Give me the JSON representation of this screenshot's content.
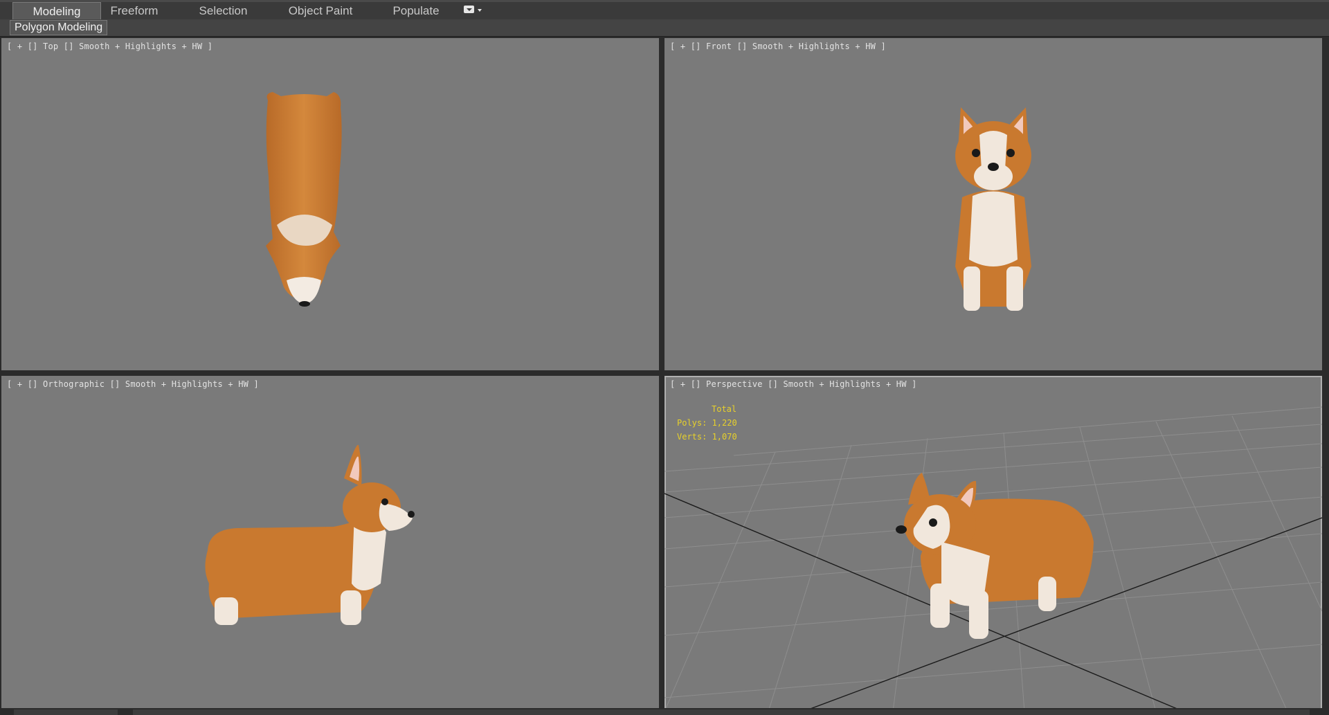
{
  "ribbon": {
    "tabs": [
      {
        "label": "Modeling",
        "active": true
      },
      {
        "label": "Freeform",
        "active": false
      },
      {
        "label": "Selection",
        "active": false
      },
      {
        "label": "Object Paint",
        "active": false
      },
      {
        "label": "Populate",
        "active": false
      }
    ],
    "extra_icon": "dropdown-icon",
    "panel_label": "Polygon Modeling"
  },
  "viewports": {
    "top_left": {
      "open": "[",
      "plus": "+",
      "bracket1": "[]",
      "name": "Top",
      "bracket2": "[]",
      "shading": "Smooth + Highlights + HW",
      "close": "]"
    },
    "top_right": {
      "open": "[",
      "plus": "+",
      "bracket1": "[]",
      "name": "Front",
      "bracket2": "[]",
      "shading": "Smooth + Highlights + HW",
      "close": "]"
    },
    "bottom_left": {
      "open": "[",
      "plus": "+",
      "bracket1": "[]",
      "name": "Orthographic",
      "bracket2": "[]",
      "shading": "Smooth + Highlights + HW",
      "close": "]"
    },
    "bottom_right": {
      "open": "[",
      "plus": "+",
      "bracket1": "[]",
      "name": "Perspective",
      "bracket2": "[]",
      "shading": "Smooth + Highlights + HW",
      "close": "]",
      "stats": {
        "total": "Total",
        "polys": "Polys: 1,220",
        "verts": "Verts: 1,070"
      }
    }
  },
  "colors": {
    "viewport_bg": "#7a7a7a",
    "stats_text": "#e8d12a",
    "corgi_fur": "#c9792f",
    "corgi_white": "#f1e7dc"
  }
}
